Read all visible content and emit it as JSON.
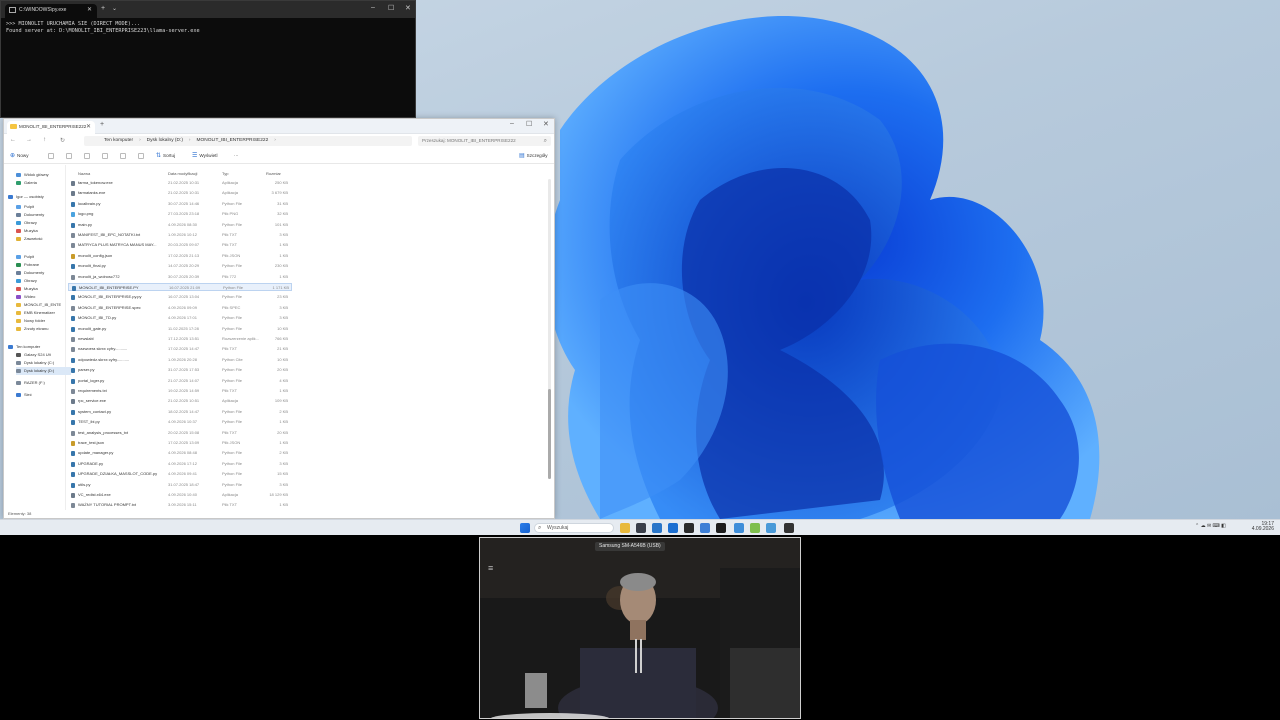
{
  "console": {
    "tab_title": "C:\\WINDOWS\\py.exe",
    "lines": [
      ">>> MIONOLIT URUCHAMIA SIE (DIRECT MODE)...",
      "Found server at: D:\\MONOLIT_IBI_ENTERPRISE223\\llama-server.exe"
    ]
  },
  "explorer": {
    "tab_title": "MONOLIT_IBI_ENTERPRISE222",
    "breadcrumb": [
      "Ten komputer",
      "Dysk lokalny (D:)",
      "MONOLIT_IBI_ENTERPRISE222"
    ],
    "search_placeholder": "Przeszukaj: MONOLIT_IBI_ENTERPRISE222",
    "toolbar": {
      "new": "Nowy",
      "sort": "Sortuj",
      "view": "Wyświetl",
      "more": "···",
      "details": "Szczegóły"
    },
    "columns": [
      "Nazwa",
      "Data modyfikacji",
      "Typ",
      "Rozmiar"
    ],
    "nav": [
      {
        "label": "Widok główny",
        "color": "#4c8fd9"
      },
      {
        "label": "Galeria",
        "color": "#2f9d6d"
      },
      {
        "label": "Igor — osobisty",
        "color": "#3b7ad1"
      },
      {
        "label": "Pulpit",
        "color": "#5aa0e6"
      },
      {
        "label": "Dokumenty",
        "color": "#6b7f99"
      },
      {
        "label": "Obrazy",
        "color": "#3a9ad8"
      },
      {
        "label": "Muzyka",
        "color": "#d9534f"
      },
      {
        "label": "Zawartość",
        "color": "#e0b235"
      },
      {
        "label": "Pulpit",
        "color": "#5aa0e6"
      },
      {
        "label": "Pobrane",
        "color": "#2a8e52"
      },
      {
        "label": "Dokumenty",
        "color": "#6b7f99"
      },
      {
        "label": "Obrazy",
        "color": "#3a9ad8"
      },
      {
        "label": "Muzyka",
        "color": "#d9534f"
      },
      {
        "label": "Wideo",
        "color": "#8a4fc8"
      },
      {
        "label": "MONOLIT_IB_ENTE",
        "color": "#e8b93c"
      },
      {
        "label": "EMB Kinematizer",
        "color": "#e8b93c"
      },
      {
        "label": "Nowy folder",
        "color": "#e8b93c"
      },
      {
        "label": "Zrzuty ekranu",
        "color": "#e8b93c"
      },
      {
        "label": "Ten komputer",
        "color": "#3b7ad1"
      },
      {
        "label": "Galaxy S24 Ult",
        "color": "#555555"
      },
      {
        "label": "Dysk lokalny (C:)",
        "color": "#7a8899"
      },
      {
        "label": "Dysk lokalny (D:)",
        "color": "#7a8899"
      },
      {
        "label": "RAZER (F:)",
        "color": "#7a8899"
      },
      {
        "label": "Sieć",
        "color": "#3b7ad1"
      }
    ],
    "files": [
      {
        "name": "farma_tokenow.exe",
        "date": "21.02.2025 10:31",
        "type": "Aplikacja",
        "size": "250 KB",
        "color": "#6c7a8a"
      },
      {
        "name": "farmatanks.exe",
        "date": "21.02.2025 10:31",
        "type": "Aplikacja",
        "size": "3 679 KB",
        "color": "#6c7a8a"
      },
      {
        "name": "localbrain.py",
        "date": "30.07.2025 14:46",
        "type": "Python File",
        "size": "31 KB",
        "color": "#3776ab"
      },
      {
        "name": "logo.png",
        "date": "27.03.2025 23:18",
        "type": "Plik PNG",
        "size": "32 KB",
        "color": "#4aa3df"
      },
      {
        "name": "main.py",
        "date": "4.09.2026 08:30",
        "type": "Python File",
        "size": "101 KB",
        "color": "#3776ab"
      },
      {
        "name": "MANIFEST_IBI_EPC_NOTATKI.txt",
        "date": "1.09.2026 10:12",
        "type": "Plik TXT",
        "size": "3 KB",
        "color": "#7d8896"
      },
      {
        "name": "MATRYCA PLUS MATRYCA MANUS MAY...",
        "date": "20.03.2025 09:07",
        "type": "Plik TXT",
        "size": "1 KB",
        "color": "#7d8896"
      },
      {
        "name": "monolit_config.json",
        "date": "17.02.2025 21:13",
        "type": "Plik JSON",
        "size": "1 KB",
        "color": "#c89b2a"
      },
      {
        "name": "monolit_final.py",
        "date": "14.07.2025 20:29",
        "type": "Python File",
        "size": "230 KB",
        "color": "#3776ab"
      },
      {
        "name": "monolit_ja_wolnosc772",
        "date": "30.07.2025 20:39",
        "type": "Plik 772",
        "size": "1 KB",
        "color": "#7d8896"
      },
      {
        "name": "MONOLIT_IBI_ENTERPRISE.PY",
        "date": "16.07.2025 21:09",
        "type": "Python File",
        "size": "1 171 KB",
        "color": "#3776ab",
        "selected": true
      },
      {
        "name": "MONOLIT_IBI_ENTERPRISE.py.py",
        "date": "16.07.2025 13:04",
        "type": "Python File",
        "size": "23 KB",
        "color": "#3776ab"
      },
      {
        "name": "MONOLIT_IBI_ENTERPRISE.spec",
        "date": "4.09.2026 09:09",
        "type": "Plik SPEC",
        "size": "3 KB",
        "color": "#7d8896"
      },
      {
        "name": "MONOLIT_IBI_TD.py",
        "date": "4.09.2026 17:01",
        "type": "Python File",
        "size": "3 KB",
        "color": "#3776ab"
      },
      {
        "name": "monolit_gate.py",
        "date": "11.02.2025 17:28",
        "type": "Python File",
        "size": "10 KB",
        "color": "#3776ab"
      },
      {
        "name": "newslabl",
        "date": "17.12.2025 13:51",
        "type": "Rozszerzenie aplik...",
        "size": "766 KB",
        "color": "#7d8896"
      },
      {
        "name": "nazwoera skrxx cyfry...........",
        "date": "17.02.2025 14:47",
        "type": "Plik TXT",
        "size": "21 KB",
        "color": "#7d8896"
      },
      {
        "name": "odpowiedz.skrxx cyfry...........",
        "date": "1.09.2026 20:28",
        "type": "Python Cite",
        "size": "10 KB",
        "color": "#3776ab"
      },
      {
        "name": "parser.py",
        "date": "31.07.2025 17:53",
        "type": "Python File",
        "size": "20 KB",
        "color": "#3776ab"
      },
      {
        "name": "portal_loger.py",
        "date": "21.07.2025 14:07",
        "type": "Python File",
        "size": "4 KB",
        "color": "#3776ab"
      },
      {
        "name": "requirements.txt",
        "date": "19.02.2025 14:59",
        "type": "Plik TXT",
        "size": "1 KB",
        "color": "#7d8896"
      },
      {
        "name": "rpc_service.exe",
        "date": "21.02.2025 10:51",
        "type": "Aplikacja",
        "size": "109 KB",
        "color": "#6c7a8a"
      },
      {
        "name": "system_contact.py",
        "date": "18.02.2025 14:47",
        "type": "Python File",
        "size": "2 KB",
        "color": "#3776ab"
      },
      {
        "name": "TEST_ibi.py",
        "date": "4.09.2026 10:37",
        "type": "Python File",
        "size": "1 KB",
        "color": "#3776ab"
      },
      {
        "name": "test_analysis_processes_txt",
        "date": "20.02.2025 15:08",
        "type": "Plik TXT",
        "size": "20 KB",
        "color": "#7d8896"
      },
      {
        "name": "trace_test.json",
        "date": "17.02.2025 13:09",
        "type": "Plik JSON",
        "size": "1 KB",
        "color": "#c89b2a"
      },
      {
        "name": "update_manager.py",
        "date": "4.09.2026 08:48",
        "type": "Python File",
        "size": "2 KB",
        "color": "#3776ab"
      },
      {
        "name": "UPGRADE.py",
        "date": "4.09.2026 17:12",
        "type": "Python File",
        "size": "3 KB",
        "color": "#3776ab"
      },
      {
        "name": "UPGRADE_DZIAŁKA_MASSLOT_CODE.py",
        "date": "4.09.2026 09:41",
        "type": "Python File",
        "size": "15 KB",
        "color": "#3776ab"
      },
      {
        "name": "utils.py",
        "date": "31.07.2025 18:47",
        "type": "Python File",
        "size": "3 KB",
        "color": "#3776ab"
      },
      {
        "name": "VC_redist.x64.exe",
        "date": "4.09.2026 10:40",
        "type": "Aplikacja",
        "size": "18 129 KB",
        "color": "#6c7a8a"
      },
      {
        "name": "WAŻNY TUTORIAL PROMPT.txt",
        "date": "3.09.2026 15:11",
        "type": "Plik TXT",
        "size": "1 KB",
        "color": "#7d8896"
      }
    ],
    "status": "Elementy: 38"
  },
  "taskbar": {
    "search": "Wyszukaj",
    "time": "19:17",
    "date": "4.09.2026",
    "icons": [
      {
        "name": "files-icon",
        "color": "#e8b93c"
      },
      {
        "name": "taskview-icon",
        "color": "#3a3f4a"
      },
      {
        "name": "explorer-icon",
        "color": "#2a76c9"
      },
      {
        "name": "mail-icon",
        "color": "#1c6fd1"
      },
      {
        "name": "obs-icon",
        "color": "#2b2b2b"
      },
      {
        "name": "chrome-icon",
        "color": "#3d7fd6"
      },
      {
        "name": "app-icon",
        "color": "#1d1d1d"
      },
      {
        "name": "folder-icon",
        "color": "#3f8ed9"
      },
      {
        "name": "notepad-icon",
        "color": "#7fbf4d"
      },
      {
        "name": "store-icon",
        "color": "#4a9ad8"
      },
      {
        "name": "terminal-icon",
        "color": "#333333"
      }
    ]
  },
  "webcam": {
    "label": "Samsung SM-A546B (USB)"
  }
}
